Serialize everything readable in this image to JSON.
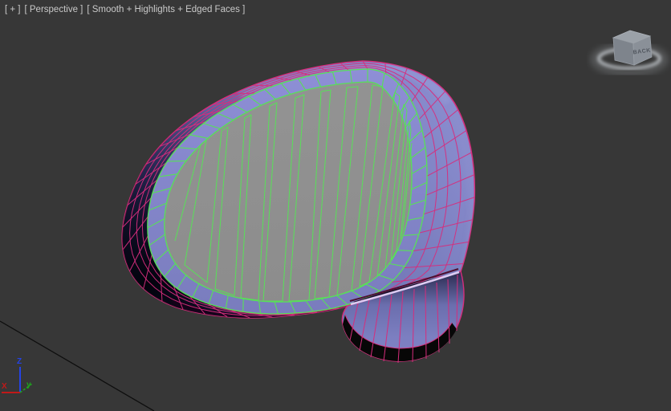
{
  "viewport": {
    "label_general": "[ + ]",
    "label_pov": "[ Perspective ]",
    "label_shading": "[ Smooth + Highlights + Edged Faces ]"
  },
  "viewcube": {
    "visible_face_label": "BACK"
  },
  "axis_gizmo": {
    "x_label": "X",
    "y_label": "y",
    "z_label": "Z"
  },
  "colors": {
    "background": "#373737",
    "viewport_text": "#c9c9c9",
    "wireframe_pink": "#d62d7c",
    "selection_green": "#58e058",
    "shell_purple": "#7478b8",
    "shell_highlight": "#9194d6",
    "shell_shadow": "#0a0a16",
    "rim_lavender": "#8e8fd6",
    "interior_gray": "#8c8c8c",
    "stem_purple": "#7c7fc1",
    "stem_band_black": "#070707",
    "highlight_stripe": "#dccbf2",
    "axis_x_red": "#c01919",
    "axis_y_green": "#1fa01f",
    "axis_z_blue": "#2443e6"
  }
}
